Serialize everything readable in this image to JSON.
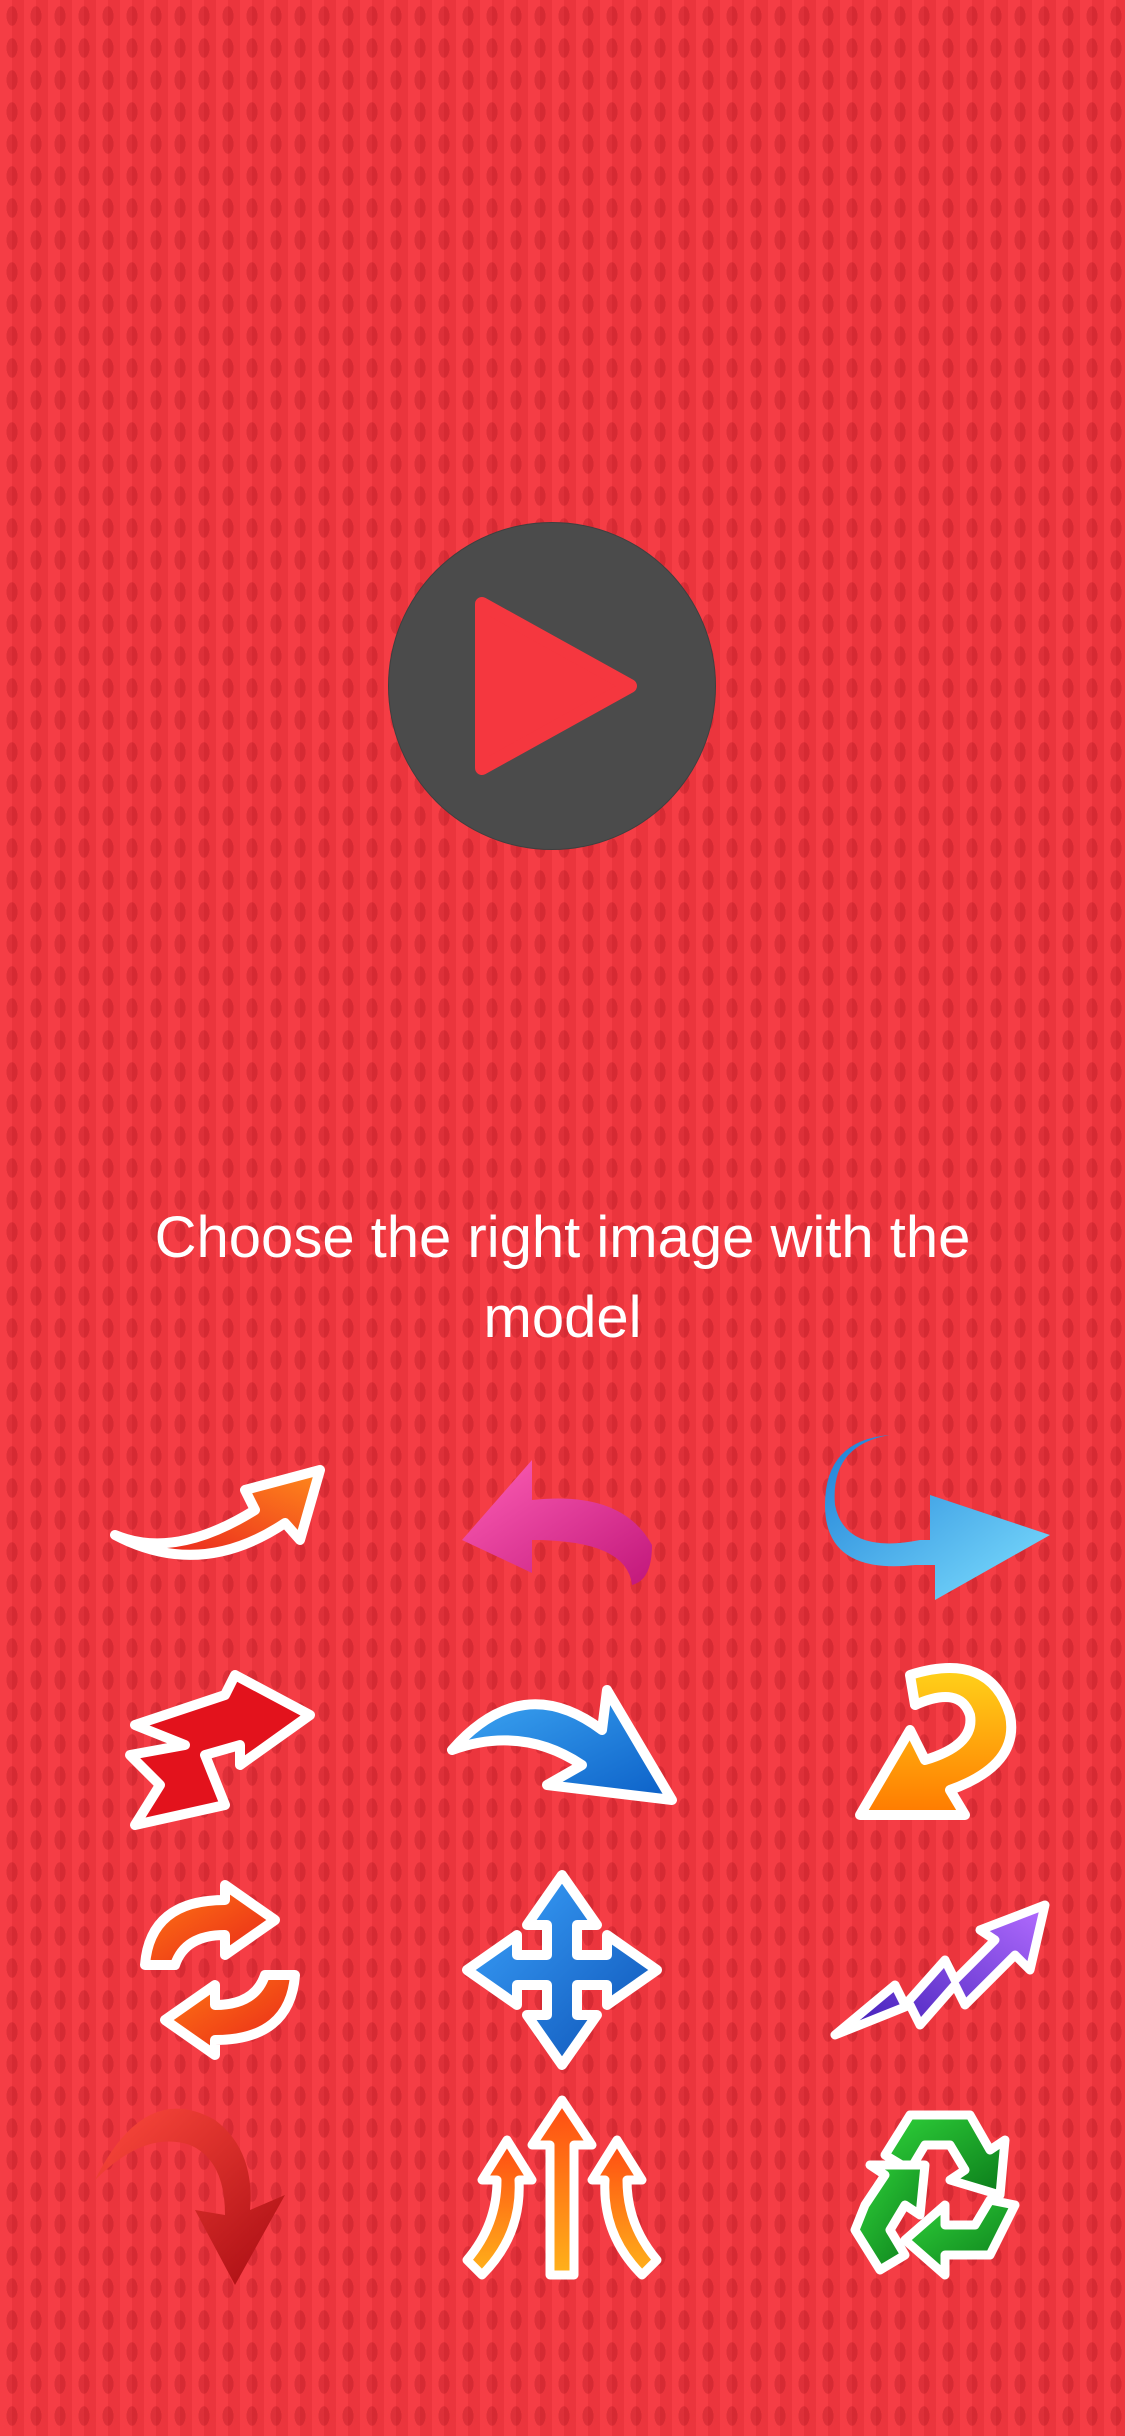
{
  "play_button": {
    "icon": "play-icon",
    "background": "#4b4b4b",
    "glyph_color": "#f5373f"
  },
  "prompt": {
    "text": "Choose the right image with the model"
  },
  "choices": [
    {
      "icon": "orange-curved-arrow-right-icon"
    },
    {
      "icon": "pink-curved-arrow-left-icon"
    },
    {
      "icon": "blue-hook-arrow-right-icon"
    },
    {
      "icon": "red-zigzag-arrow-icon"
    },
    {
      "icon": "blue-arc-arrow-right-icon"
    },
    {
      "icon": "yellow-u-turn-arrow-icon"
    },
    {
      "icon": "orange-refresh-arrows-icon"
    },
    {
      "icon": "blue-four-way-arrow-icon"
    },
    {
      "icon": "purple-lightning-arrow-icon"
    },
    {
      "icon": "red-3d-curved-arrow-down-icon"
    },
    {
      "icon": "orange-triple-up-arrow-icon"
    },
    {
      "icon": "green-recycle-icon"
    }
  ]
}
